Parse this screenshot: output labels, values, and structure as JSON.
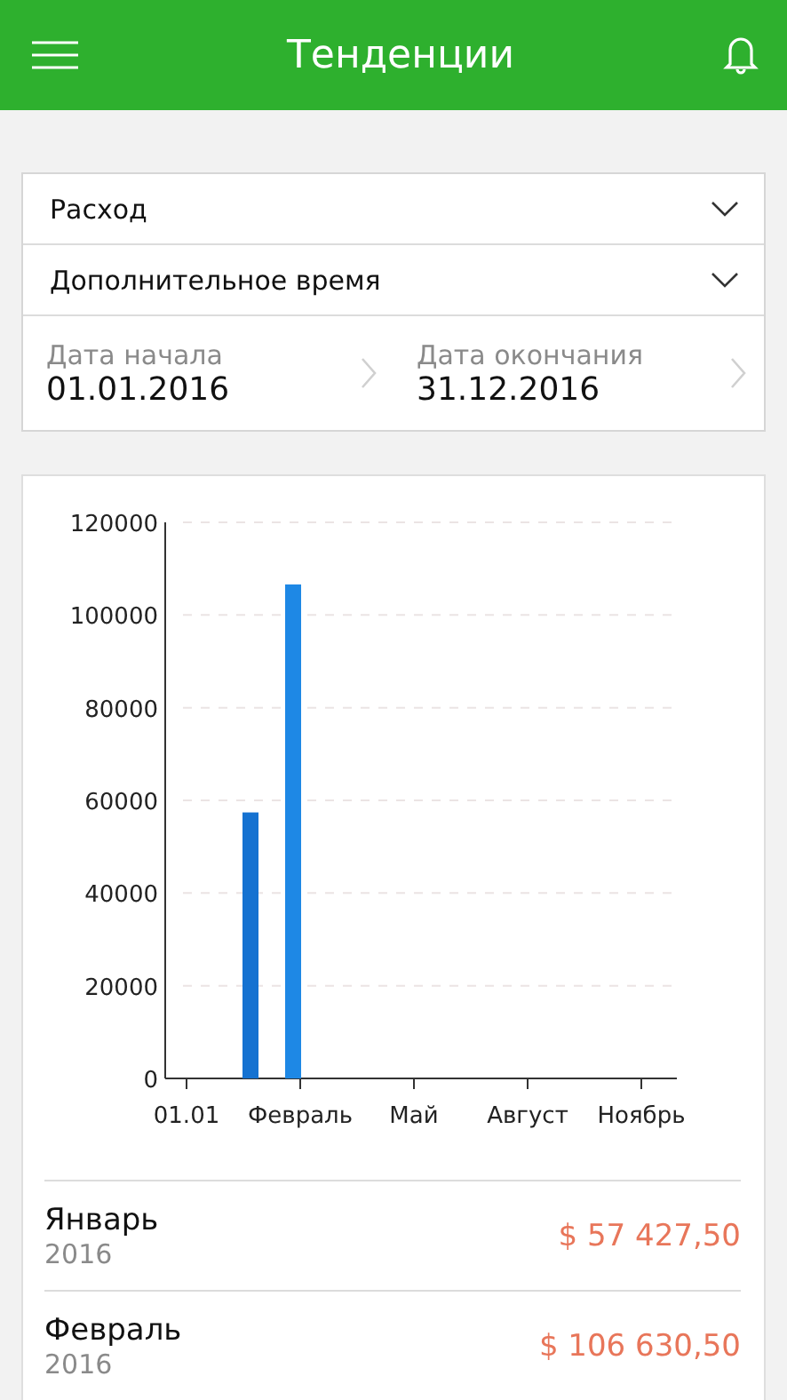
{
  "header": {
    "title": "Тенденции"
  },
  "filters": [
    {
      "label": "Расход"
    },
    {
      "label": "Дополнительное время"
    }
  ],
  "dates": [
    {
      "label": "Дата начала",
      "value": "01.01.2016"
    },
    {
      "label": "Дата окончания",
      "value": "31.12.2016"
    }
  ],
  "chart_data": {
    "type": "bar",
    "grid": true,
    "ylim": [
      0,
      120000
    ],
    "categories": [
      "01.01",
      null,
      null,
      null,
      "Февраль",
      null,
      null,
      null,
      "Май",
      null,
      null,
      null,
      "Август",
      null,
      null,
      null,
      "Ноябрь"
    ],
    "values": [
      null,
      null,
      57400,
      null,
      106600,
      null,
      null,
      null,
      null,
      null,
      null,
      null,
      null,
      null,
      null,
      null,
      null
    ],
    "yticks": [
      0,
      20000,
      40000,
      60000,
      80000,
      100000,
      120000
    ]
  },
  "entries": [
    {
      "month": "Январь",
      "year": "2016",
      "amount": "$ 57 427,50"
    },
    {
      "month": "Февраль",
      "year": "2016",
      "amount": "$ 106 630,50"
    }
  ]
}
